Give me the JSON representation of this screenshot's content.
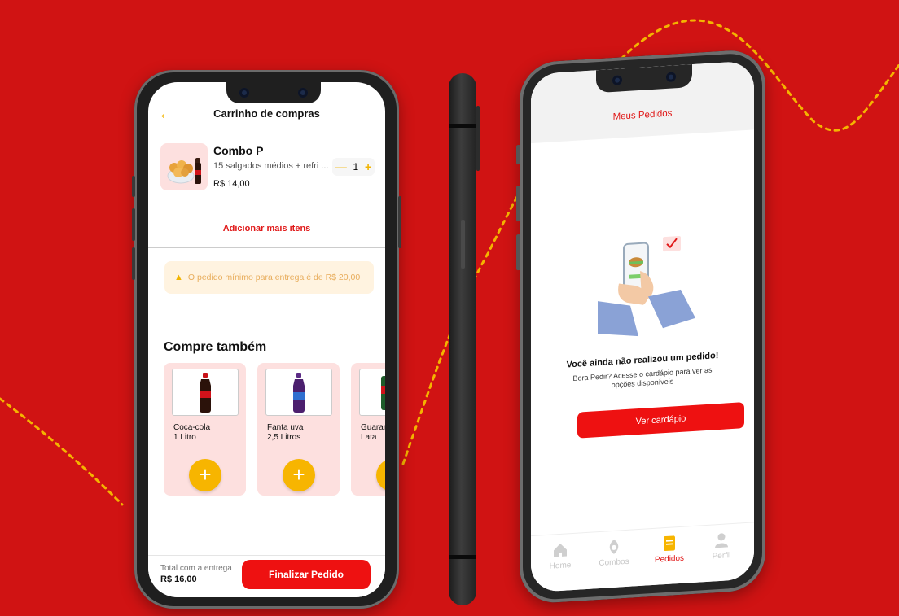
{
  "colors": {
    "background": "#d01313",
    "accent_red": "#ee1111",
    "accent_yellow": "#f7b500",
    "card_pink": "#fde0df"
  },
  "cart_screen": {
    "header": {
      "back_icon": "back-arrow-icon",
      "title": "Carrinho de compras"
    },
    "cart_item": {
      "name": "Combo P",
      "description": "15 salgados médios + refri ...",
      "price": "R$ 14,00",
      "quantity": "1",
      "minus_label": "—",
      "plus_label": "+"
    },
    "add_more_label": "Adicionar mais itens",
    "min_order_warning": "O pedido mínimo para entrega é de R$ 20,00",
    "section_title": "Compre também",
    "products": [
      {
        "name": "Coca-cola\n1 Litro"
      },
      {
        "name": "Fanta uva\n2,5 Litros"
      },
      {
        "name": "Guaraná\nLata"
      }
    ],
    "footer": {
      "total_label": "Total com a entrega",
      "total_value": "R$ 16,00",
      "finalize_label": "Finalizar Pedido"
    }
  },
  "orders_screen": {
    "title": "Meus Pedidos",
    "empty_title": "Você ainda não realizou um pedido!",
    "empty_subtitle": "Bora Pedir? Acesse o cardápio para ver as opções disponíveis",
    "menu_button_label": "Ver cardápio",
    "tabs": [
      {
        "label": "Home",
        "icon": "home-icon",
        "active": false
      },
      {
        "label": "Combos",
        "icon": "combos-icon",
        "active": false
      },
      {
        "label": "Pedidos",
        "icon": "orders-icon",
        "active": true
      },
      {
        "label": "Perfil",
        "icon": "profile-icon",
        "active": false
      }
    ]
  }
}
